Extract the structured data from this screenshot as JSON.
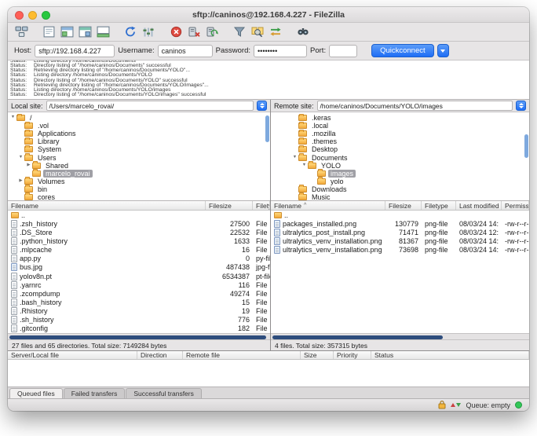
{
  "window": {
    "title": "sftp://caninos@192.168.4.227 - FileZilla"
  },
  "toolbar": {
    "icons": [
      "site-manager",
      "message-log-toggle",
      "local-tree-toggle",
      "remote-tree-toggle",
      "transfer-queue-toggle",
      "refresh",
      "process-queue",
      "cancel",
      "disconnect",
      "reconnect",
      "filter",
      "compare",
      "synchronized-browsing",
      "find-files"
    ]
  },
  "quickconnect": {
    "host_label": "Host:",
    "host_value": "sftp://192.168.4.227",
    "username_label": "Username:",
    "username_value": "caninos",
    "password_label": "Password:",
    "password_value": "••••••••",
    "port_label": "Port:",
    "port_value": "",
    "button_label": "Quickconnect"
  },
  "log": {
    "prefix": "Status:",
    "entries": [
      "Listing directory /home/caninos/Documents",
      "Directory listing of \"/home/caninos/Documents\" successful",
      "Retrieving directory listing of \"/home/caninos/Documents/YOLO\"...",
      "Listing directory /home/caninos/Documents/YOLO",
      "Directory listing of \"/home/caninos/Documents/YOLO\" successful",
      "Retrieving directory listing of \"/home/caninos/Documents/YOLO/images\"...",
      "Listing directory /home/caninos/Documents/YOLO/images",
      "Directory listing of \"/home/caninos/Documents/YOLO/images\" successful"
    ]
  },
  "local": {
    "site_label": "Local site:",
    "site_value": "/Users/marcelo_rovai/",
    "tree": [
      {
        "label": "/"
      },
      {
        "label": ".vol"
      },
      {
        "label": "Applications"
      },
      {
        "label": "Library"
      },
      {
        "label": "System"
      },
      {
        "label": "Users"
      },
      {
        "label": "Shared"
      },
      {
        "label": "marcelo_rovai"
      },
      {
        "label": "Volumes"
      },
      {
        "label": "bin"
      },
      {
        "label": "cores"
      }
    ],
    "columns": [
      "Filename",
      "Filesize",
      "Filetype"
    ],
    "files": [
      {
        "name": "..",
        "size": "",
        "type": ""
      },
      {
        "name": ".zsh_history",
        "size": "27500",
        "type": "File"
      },
      {
        "name": ".DS_Store",
        "size": "22532",
        "type": "File"
      },
      {
        "name": ".python_history",
        "size": "1633",
        "type": "File"
      },
      {
        "name": ".mlpcache",
        "size": "16",
        "type": "File"
      },
      {
        "name": "app.py",
        "size": "0",
        "type": "py-file"
      },
      {
        "name": "bus.jpg",
        "size": "487438",
        "type": "jpg-file"
      },
      {
        "name": "yolov8n.pt",
        "size": "6534387",
        "type": "pt-file"
      },
      {
        "name": ".yarnrc",
        "size": "116",
        "type": "File"
      },
      {
        "name": ".zcompdump",
        "size": "49274",
        "type": "File"
      },
      {
        "name": ".bash_history",
        "size": "15",
        "type": "File"
      },
      {
        "name": ".Rhistory",
        "size": "19",
        "type": "File"
      },
      {
        "name": ".sh_history",
        "size": "776",
        "type": "File"
      },
      {
        "name": ".gitconfig",
        "size": "182",
        "type": "File"
      }
    ],
    "status": "27 files and 65 directories. Total size: 7149284 bytes"
  },
  "remote": {
    "site_label": "Remote site:",
    "site_value": "/home/caninos/Documents/YOLO/images",
    "sort_indicator": "^",
    "tree": [
      {
        "label": ".keras"
      },
      {
        "label": ".local"
      },
      {
        "label": ".mozilla"
      },
      {
        "label": ".themes"
      },
      {
        "label": "Desktop"
      },
      {
        "label": "Documents"
      },
      {
        "label": "YOLO"
      },
      {
        "label": "images"
      },
      {
        "label": "yolo"
      },
      {
        "label": "Downloads"
      },
      {
        "label": "Music"
      }
    ],
    "columns": [
      "Filename",
      "Filesize",
      "Filetype",
      "Last modified",
      "Permissions"
    ],
    "files": [
      {
        "name": "..",
        "size": "",
        "type": "",
        "modified": "",
        "perms": ""
      },
      {
        "name": "packages_installed.png",
        "size": "130779",
        "type": "png-file",
        "modified": "08/03/24 14:",
        "perms": "-rw-r--r--"
      },
      {
        "name": "ultralytics_post_install.png",
        "size": "71471",
        "type": "png-file",
        "modified": "08/03/24 12:",
        "perms": "-rw-r--r--"
      },
      {
        "name": "ultralytics_venv_installation.png",
        "size": "81367",
        "type": "png-file",
        "modified": "08/03/24 14:",
        "perms": "-rw-r--r--"
      },
      {
        "name": "ultralytics_venv_installation.png",
        "size": "73698",
        "type": "png-file",
        "modified": "08/03/24 14:",
        "perms": "-rw-r--r--"
      }
    ],
    "status": "4 files. Total size: 357315 bytes"
  },
  "queue": {
    "columns": [
      "Server/Local file",
      "Direction",
      "Remote file",
      "Size",
      "Priority",
      "Status"
    ],
    "tabs": [
      "Queued files",
      "Failed transfers",
      "Successful transfers"
    ],
    "active_tab": "Queued files"
  },
  "statusbar": {
    "queue_text": "Queue: empty"
  }
}
